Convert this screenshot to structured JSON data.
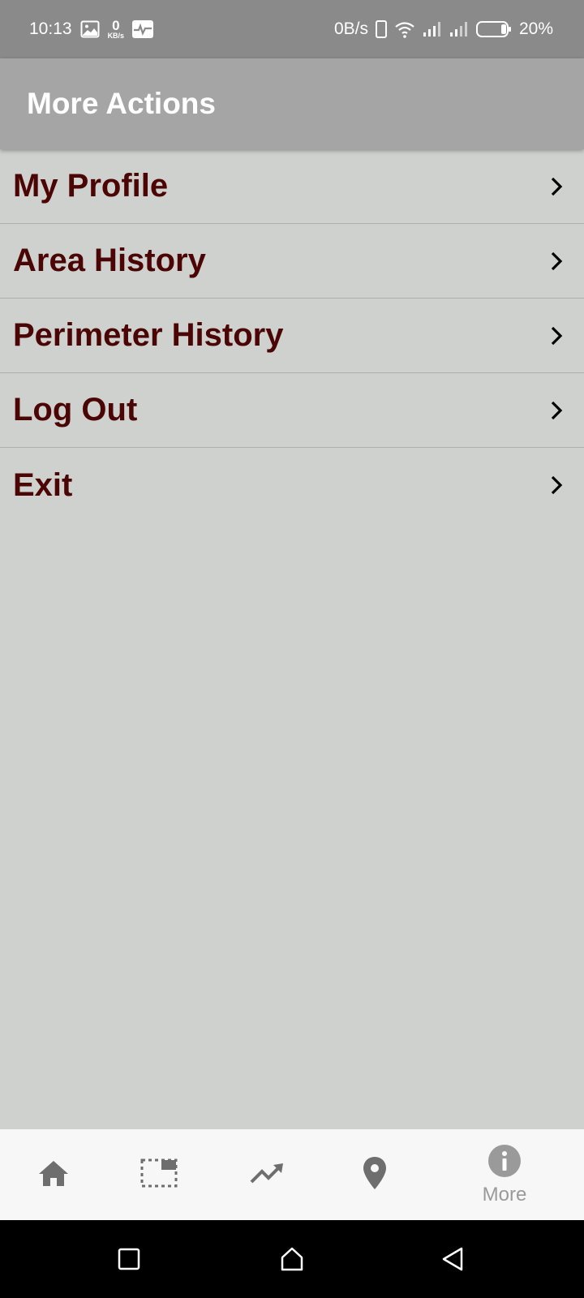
{
  "status_bar": {
    "time": "10:13",
    "net_speed_value": "0",
    "net_speed_unit": "KB/s",
    "data_rate": "0B/s",
    "battery": "20%",
    "icons": [
      "image-icon",
      "activity-icon",
      "phone-outline-icon",
      "wifi-icon",
      "signal-icon",
      "signal-icon",
      "battery-icon"
    ]
  },
  "app_bar": {
    "title": "More Actions"
  },
  "menu": {
    "items": [
      {
        "label": "My Profile"
      },
      {
        "label": "Area History"
      },
      {
        "label": "Perimeter History"
      },
      {
        "label": "Log Out"
      },
      {
        "label": "Exit"
      }
    ]
  },
  "bottom_nav": {
    "items": [
      {
        "icon": "home-icon"
      },
      {
        "icon": "area-select-icon"
      },
      {
        "icon": "trending-up-icon"
      },
      {
        "icon": "location-pin-icon"
      },
      {
        "icon": "info-icon",
        "label": "More"
      }
    ]
  },
  "colors": {
    "status_bar": "#8a8a8a",
    "app_bar": "#a5a5a5",
    "background": "#cfd1ce",
    "menu_text": "#4b0505",
    "nav_icon": "#6e6e6e",
    "nav_active": "#9a9a9a"
  }
}
